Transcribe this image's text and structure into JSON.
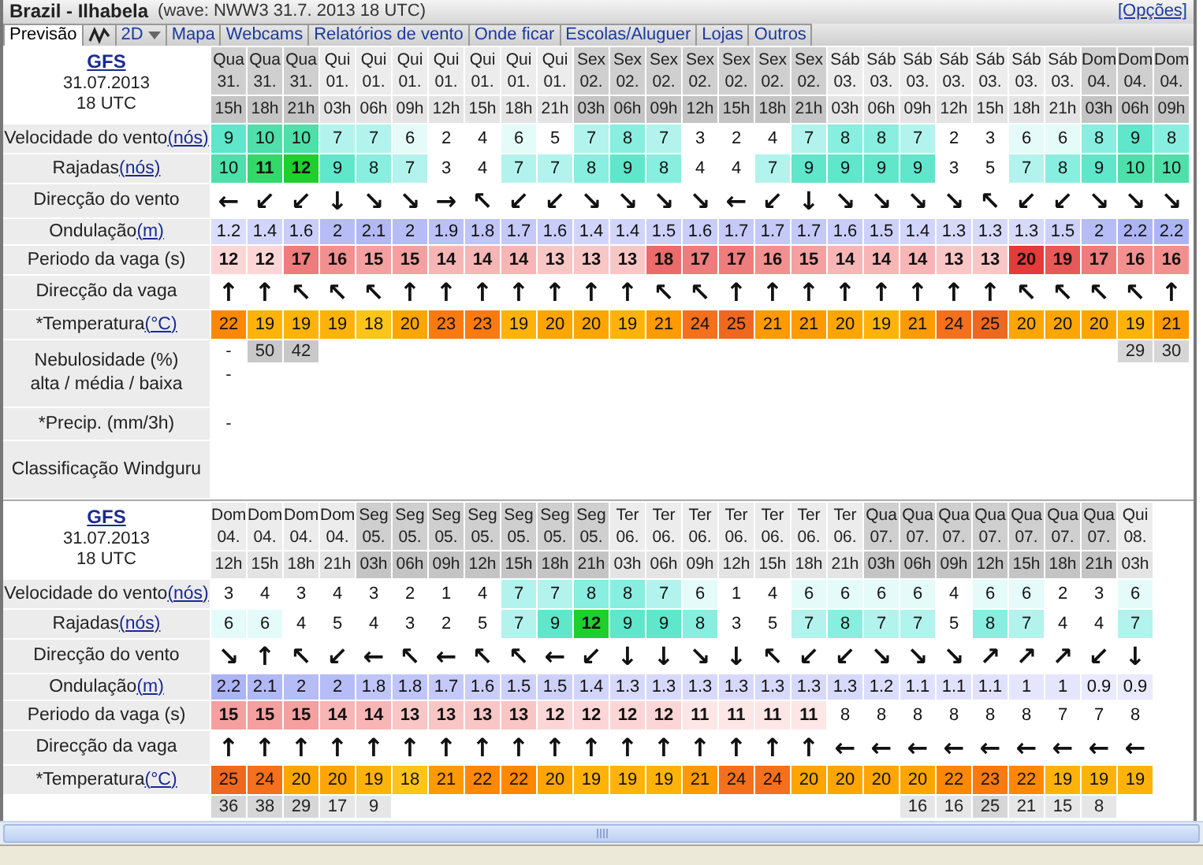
{
  "header": {
    "title": "Brazil - Ilhabela",
    "subtitle": "(wave: NWW3 31.7. 2013 18 UTC)",
    "options_link": "[Opções]"
  },
  "tabs": [
    {
      "kind": "text",
      "label": "Previsão",
      "selected": true
    },
    {
      "kind": "graph",
      "selected": false
    },
    {
      "kind": "dropdown",
      "label": "2D",
      "selected": false
    },
    {
      "kind": "text",
      "label": "Mapa",
      "selected": false
    },
    {
      "kind": "text",
      "label": "Webcams",
      "selected": false
    },
    {
      "kind": "text",
      "label": "Relatórios de vento",
      "selected": false
    },
    {
      "kind": "text",
      "label": "Onde ficar",
      "selected": false
    },
    {
      "kind": "text",
      "label": "Escolas/Aluguer",
      "selected": false
    },
    {
      "kind": "text",
      "label": "Lojas",
      "selected": false
    },
    {
      "kind": "text",
      "label": "Outros",
      "selected": false
    }
  ],
  "forecasts": [
    {
      "model": "GFS",
      "date": "31.07.2013",
      "time": "18 UTC",
      "columns": [
        {
          "day": "Qua",
          "date": "31.",
          "hour": "15h",
          "dark": true,
          "cloud": "-",
          "cloud_2": "-",
          "precip": "-"
        },
        {
          "day": "Qua",
          "date": "31.",
          "hour": "18h",
          "dark": true,
          "cloud": "50"
        },
        {
          "day": "Qua",
          "date": "31.",
          "hour": "21h",
          "dark": true,
          "cloud": "42"
        },
        {
          "day": "Qui",
          "date": "01.",
          "hour": "03h",
          "dark": false
        },
        {
          "day": "Qui",
          "date": "01.",
          "hour": "06h",
          "dark": false
        },
        {
          "day": "Qui",
          "date": "01.",
          "hour": "09h",
          "dark": false
        },
        {
          "day": "Qui",
          "date": "01.",
          "hour": "12h",
          "dark": false
        },
        {
          "day": "Qui",
          "date": "01.",
          "hour": "15h",
          "dark": false
        },
        {
          "day": "Qui",
          "date": "01.",
          "hour": "18h",
          "dark": false
        },
        {
          "day": "Qui",
          "date": "01.",
          "hour": "21h",
          "dark": false
        },
        {
          "day": "Sex",
          "date": "02.",
          "hour": "03h",
          "dark": true
        },
        {
          "day": "Sex",
          "date": "02.",
          "hour": "06h",
          "dark": true
        },
        {
          "day": "Sex",
          "date": "02.",
          "hour": "09h",
          "dark": true
        },
        {
          "day": "Sex",
          "date": "02.",
          "hour": "12h",
          "dark": true
        },
        {
          "day": "Sex",
          "date": "02.",
          "hour": "15h",
          "dark": true
        },
        {
          "day": "Sex",
          "date": "02.",
          "hour": "18h",
          "dark": true
        },
        {
          "day": "Sex",
          "date": "02.",
          "hour": "21h",
          "dark": true
        },
        {
          "day": "Sáb",
          "date": "03.",
          "hour": "03h",
          "dark": false
        },
        {
          "day": "Sáb",
          "date": "03.",
          "hour": "06h",
          "dark": false
        },
        {
          "day": "Sáb",
          "date": "03.",
          "hour": "09h",
          "dark": false
        },
        {
          "day": "Sáb",
          "date": "03.",
          "hour": "12h",
          "dark": false
        },
        {
          "day": "Sáb",
          "date": "03.",
          "hour": "15h",
          "dark": false
        },
        {
          "day": "Sáb",
          "date": "03.",
          "hour": "18h",
          "dark": false
        },
        {
          "day": "Sáb",
          "date": "03.",
          "hour": "21h",
          "dark": false
        },
        {
          "day": "Dom",
          "date": "04.",
          "hour": "03h",
          "dark": true
        },
        {
          "day": "Dom",
          "date": "04.",
          "hour": "06h",
          "dark": true,
          "cloud": "29"
        },
        {
          "day": "Dom",
          "date": "04.",
          "hour": "09h",
          "dark": true,
          "cloud": "30"
        }
      ],
      "rows": [
        {
          "kind": "wind",
          "label": "Velocidade do vento",
          "unit": "(nós)",
          "cells": [
            "9",
            "10",
            "10",
            "7",
            "7",
            "6",
            "2",
            "4",
            "6",
            "5",
            "7",
            "8",
            "7",
            "3",
            "2",
            "4",
            "7",
            "8",
            "8",
            "7",
            "2",
            "3",
            "6",
            "6",
            "8",
            "9",
            "8"
          ]
        },
        {
          "kind": "wind",
          "label": "Rajadas",
          "unit": "(nós)",
          "cells": [
            "10",
            "11",
            "12",
            "9",
            "8",
            "7",
            "3",
            "4",
            "7",
            "7",
            "8",
            "9",
            "8",
            "4",
            "4",
            "7",
            "9",
            "9",
            "9",
            "9",
            "3",
            "5",
            "7",
            "8",
            "9",
            "10",
            "10"
          ]
        },
        {
          "kind": "arrow",
          "label": "Direcção do vento",
          "cells": [
            "←",
            "↙",
            "↙",
            "↓",
            "↘",
            "↘",
            "→",
            "↖",
            "↙",
            "↙",
            "↘",
            "↘",
            "↘",
            "↘",
            "←",
            "↙",
            "↓",
            "↘",
            "↘",
            "↘",
            "↘",
            "↖",
            "↙",
            "↙",
            "↘",
            "↘",
            "↘"
          ]
        },
        {
          "kind": "swell",
          "label": "Ondulação",
          "unit": "(m)",
          "cells": [
            "1.2",
            "1.4",
            "1.6",
            "2",
            "2.1",
            "2",
            "1.9",
            "1.8",
            "1.7",
            "1.6",
            "1.4",
            "1.4",
            "1.5",
            "1.6",
            "1.7",
            "1.7",
            "1.7",
            "1.6",
            "1.5",
            "1.4",
            "1.3",
            "1.3",
            "1.3",
            "1.5",
            "2",
            "2.2",
            "2.2"
          ]
        },
        {
          "kind": "period",
          "label": "Periodo da vaga (s)",
          "cells": [
            "12",
            "12",
            "17",
            "16",
            "15",
            "15",
            "14",
            "14",
            "14",
            "13",
            "13",
            "13",
            "18",
            "17",
            "17",
            "16",
            "15",
            "14",
            "14",
            "14",
            "13",
            "13",
            "20",
            "19",
            "17",
            "16",
            "16"
          ]
        },
        {
          "kind": "arrow",
          "label": "Direcção da vaga",
          "cells": [
            "↑",
            "↑",
            "↖",
            "↖",
            "↖",
            "↑",
            "↑",
            "↑",
            "↑",
            "↑",
            "↑",
            "↑",
            "↖",
            "↖",
            "↑",
            "↑",
            "↑",
            "↑",
            "↑",
            "↑",
            "↑",
            "↑",
            "↖",
            "↖",
            "↖",
            "↖",
            "↑"
          ]
        },
        {
          "kind": "temp",
          "label": "*Temperatura",
          "unit": "(°C)",
          "cells": [
            "22",
            "19",
            "19",
            "19",
            "18",
            "20",
            "23",
            "23",
            "19",
            "20",
            "20",
            "19",
            "21",
            "24",
            "25",
            "21",
            "21",
            "20",
            "19",
            "21",
            "24",
            "25",
            "20",
            "20",
            "20",
            "19",
            "21"
          ]
        },
        {
          "kind": "cloud",
          "label": "Nebulosidade (%)",
          "label_2": "alta / média / baixa"
        },
        {
          "kind": "precip",
          "label": "*Precip. (mm/3h)"
        },
        {
          "kind": "rating",
          "label": "Classificação Windguru"
        }
      ]
    },
    {
      "model": "GFS",
      "date": "31.07.2013",
      "time": "18 UTC",
      "columns": [
        {
          "day": "Dom",
          "date": "04.",
          "hour": "12h",
          "dark": false,
          "cloud": "36"
        },
        {
          "day": "Dom",
          "date": "04.",
          "hour": "15h",
          "dark": false,
          "cloud": "38"
        },
        {
          "day": "Dom",
          "date": "04.",
          "hour": "18h",
          "dark": false,
          "cloud": "29"
        },
        {
          "day": "Dom",
          "date": "04.",
          "hour": "21h",
          "dark": false,
          "cloud": "17"
        },
        {
          "day": "Seg",
          "date": "05.",
          "hour": "03h",
          "dark": true,
          "cloud": "9"
        },
        {
          "day": "Seg",
          "date": "05.",
          "hour": "06h",
          "dark": true
        },
        {
          "day": "Seg",
          "date": "05.",
          "hour": "09h",
          "dark": true
        },
        {
          "day": "Seg",
          "date": "05.",
          "hour": "12h",
          "dark": true
        },
        {
          "day": "Seg",
          "date": "05.",
          "hour": "15h",
          "dark": true
        },
        {
          "day": "Seg",
          "date": "05.",
          "hour": "18h",
          "dark": true
        },
        {
          "day": "Seg",
          "date": "05.",
          "hour": "21h",
          "dark": true
        },
        {
          "day": "Ter",
          "date": "06.",
          "hour": "03h",
          "dark": false
        },
        {
          "day": "Ter",
          "date": "06.",
          "hour": "06h",
          "dark": false
        },
        {
          "day": "Ter",
          "date": "06.",
          "hour": "09h",
          "dark": false
        },
        {
          "day": "Ter",
          "date": "06.",
          "hour": "12h",
          "dark": false
        },
        {
          "day": "Ter",
          "date": "06.",
          "hour": "15h",
          "dark": false
        },
        {
          "day": "Ter",
          "date": "06.",
          "hour": "18h",
          "dark": false
        },
        {
          "day": "Ter",
          "date": "06.",
          "hour": "21h",
          "dark": false
        },
        {
          "day": "Qua",
          "date": "07.",
          "hour": "03h",
          "dark": true
        },
        {
          "day": "Qua",
          "date": "07.",
          "hour": "06h",
          "dark": true,
          "cloud": "16"
        },
        {
          "day": "Qua",
          "date": "07.",
          "hour": "09h",
          "dark": true,
          "cloud": "16"
        },
        {
          "day": "Qua",
          "date": "07.",
          "hour": "12h",
          "dark": true,
          "cloud": "25"
        },
        {
          "day": "Qua",
          "date": "07.",
          "hour": "15h",
          "dark": true,
          "cloud": "21"
        },
        {
          "day": "Qua",
          "date": "07.",
          "hour": "18h",
          "dark": true,
          "cloud": "15"
        },
        {
          "day": "Qua",
          "date": "07.",
          "hour": "21h",
          "dark": true,
          "cloud": "8"
        },
        {
          "day": "Qui",
          "date": "08.",
          "hour": "03h",
          "dark": false
        }
      ],
      "rows": [
        {
          "kind": "wind",
          "label": "Velocidade do vento",
          "unit": "(nós)",
          "cells": [
            "3",
            "4",
            "3",
            "4",
            "3",
            "2",
            "1",
            "4",
            "7",
            "7",
            "8",
            "8",
            "7",
            "6",
            "1",
            "4",
            "6",
            "6",
            "6",
            "6",
            "4",
            "6",
            "6",
            "2",
            "3",
            "6"
          ]
        },
        {
          "kind": "wind",
          "label": "Rajadas",
          "unit": "(nós)",
          "cells": [
            "6",
            "6",
            "4",
            "5",
            "4",
            "3",
            "2",
            "5",
            "7",
            "9",
            "12",
            "9",
            "9",
            "8",
            "3",
            "5",
            "7",
            "8",
            "7",
            "7",
            "5",
            "8",
            "7",
            "4",
            "4",
            "7"
          ]
        },
        {
          "kind": "arrow",
          "label": "Direcção do vento",
          "cells": [
            "↘",
            "↑",
            "↖",
            "↙",
            "←",
            "↖",
            "←",
            "↖",
            "↖",
            "←",
            "↙",
            "↓",
            "↓",
            "↘",
            "↓",
            "↖",
            "↙",
            "↙",
            "↘",
            "↘",
            "↘",
            "↗",
            "↗",
            "↗",
            "↙",
            "↓"
          ]
        },
        {
          "kind": "swell",
          "label": "Ondulação",
          "unit": "(m)",
          "cells": [
            "2.2",
            "2.1",
            "2",
            "2",
            "1.8",
            "1.8",
            "1.7",
            "1.6",
            "1.5",
            "1.5",
            "1.4",
            "1.3",
            "1.3",
            "1.3",
            "1.3",
            "1.3",
            "1.3",
            "1.3",
            "1.2",
            "1.1",
            "1.1",
            "1.1",
            "1",
            "1",
            "0.9",
            "0.9"
          ]
        },
        {
          "kind": "period",
          "label": "Periodo da vaga (s)",
          "cells": [
            "15",
            "15",
            "15",
            "14",
            "14",
            "13",
            "13",
            "13",
            "13",
            "12",
            "12",
            "12",
            "12",
            "11",
            "11",
            "11",
            "11",
            "8",
            "8",
            "8",
            "8",
            "8",
            "8",
            "7",
            "7",
            "8"
          ]
        },
        {
          "kind": "arrow",
          "label": "Direcção da vaga",
          "cells": [
            "↑",
            "↑",
            "↑",
            "↑",
            "↑",
            "↑",
            "↑",
            "↑",
            "↑",
            "↑",
            "↑",
            "↑",
            "↑",
            "↑",
            "↑",
            "↑",
            "↑",
            "←",
            "←",
            "←",
            "←",
            "←",
            "←",
            "←",
            "←",
            "←"
          ]
        },
        {
          "kind": "temp",
          "label": "*Temperatura",
          "unit": "(°C)",
          "cells": [
            "25",
            "24",
            "20",
            "20",
            "19",
            "18",
            "21",
            "22",
            "22",
            "20",
            "19",
            "19",
            "19",
            "21",
            "24",
            "24",
            "20",
            "20",
            "20",
            "20",
            "22",
            "23",
            "22",
            "19",
            "19",
            "19"
          ]
        },
        {
          "kind": "cloud"
        }
      ]
    }
  ]
}
